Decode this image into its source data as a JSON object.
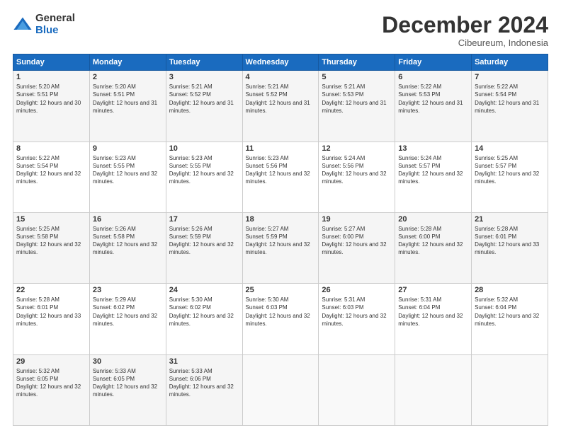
{
  "logo": {
    "general": "General",
    "blue": "Blue"
  },
  "title": "December 2024",
  "location": "Cibeureum, Indonesia",
  "days_of_week": [
    "Sunday",
    "Monday",
    "Tuesday",
    "Wednesday",
    "Thursday",
    "Friday",
    "Saturday"
  ],
  "weeks": [
    [
      {
        "day": "1",
        "sunrise": "5:20 AM",
        "sunset": "5:51 PM",
        "daylight": "12 hours and 30 minutes."
      },
      {
        "day": "2",
        "sunrise": "5:20 AM",
        "sunset": "5:51 PM",
        "daylight": "12 hours and 31 minutes."
      },
      {
        "day": "3",
        "sunrise": "5:21 AM",
        "sunset": "5:52 PM",
        "daylight": "12 hours and 31 minutes."
      },
      {
        "day": "4",
        "sunrise": "5:21 AM",
        "sunset": "5:52 PM",
        "daylight": "12 hours and 31 minutes."
      },
      {
        "day": "5",
        "sunrise": "5:21 AM",
        "sunset": "5:53 PM",
        "daylight": "12 hours and 31 minutes."
      },
      {
        "day": "6",
        "sunrise": "5:22 AM",
        "sunset": "5:53 PM",
        "daylight": "12 hours and 31 minutes."
      },
      {
        "day": "7",
        "sunrise": "5:22 AM",
        "sunset": "5:54 PM",
        "daylight": "12 hours and 31 minutes."
      }
    ],
    [
      {
        "day": "8",
        "sunrise": "5:22 AM",
        "sunset": "5:54 PM",
        "daylight": "12 hours and 32 minutes."
      },
      {
        "day": "9",
        "sunrise": "5:23 AM",
        "sunset": "5:55 PM",
        "daylight": "12 hours and 32 minutes."
      },
      {
        "day": "10",
        "sunrise": "5:23 AM",
        "sunset": "5:55 PM",
        "daylight": "12 hours and 32 minutes."
      },
      {
        "day": "11",
        "sunrise": "5:23 AM",
        "sunset": "5:56 PM",
        "daylight": "12 hours and 32 minutes."
      },
      {
        "day": "12",
        "sunrise": "5:24 AM",
        "sunset": "5:56 PM",
        "daylight": "12 hours and 32 minutes."
      },
      {
        "day": "13",
        "sunrise": "5:24 AM",
        "sunset": "5:57 PM",
        "daylight": "12 hours and 32 minutes."
      },
      {
        "day": "14",
        "sunrise": "5:25 AM",
        "sunset": "5:57 PM",
        "daylight": "12 hours and 32 minutes."
      }
    ],
    [
      {
        "day": "15",
        "sunrise": "5:25 AM",
        "sunset": "5:58 PM",
        "daylight": "12 hours and 32 minutes."
      },
      {
        "day": "16",
        "sunrise": "5:26 AM",
        "sunset": "5:58 PM",
        "daylight": "12 hours and 32 minutes."
      },
      {
        "day": "17",
        "sunrise": "5:26 AM",
        "sunset": "5:59 PM",
        "daylight": "12 hours and 32 minutes."
      },
      {
        "day": "18",
        "sunrise": "5:27 AM",
        "sunset": "5:59 PM",
        "daylight": "12 hours and 32 minutes."
      },
      {
        "day": "19",
        "sunrise": "5:27 AM",
        "sunset": "6:00 PM",
        "daylight": "12 hours and 32 minutes."
      },
      {
        "day": "20",
        "sunrise": "5:28 AM",
        "sunset": "6:00 PM",
        "daylight": "12 hours and 32 minutes."
      },
      {
        "day": "21",
        "sunrise": "5:28 AM",
        "sunset": "6:01 PM",
        "daylight": "12 hours and 33 minutes."
      }
    ],
    [
      {
        "day": "22",
        "sunrise": "5:28 AM",
        "sunset": "6:01 PM",
        "daylight": "12 hours and 33 minutes."
      },
      {
        "day": "23",
        "sunrise": "5:29 AM",
        "sunset": "6:02 PM",
        "daylight": "12 hours and 32 minutes."
      },
      {
        "day": "24",
        "sunrise": "5:30 AM",
        "sunset": "6:02 PM",
        "daylight": "12 hours and 32 minutes."
      },
      {
        "day": "25",
        "sunrise": "5:30 AM",
        "sunset": "6:03 PM",
        "daylight": "12 hours and 32 minutes."
      },
      {
        "day": "26",
        "sunrise": "5:31 AM",
        "sunset": "6:03 PM",
        "daylight": "12 hours and 32 minutes."
      },
      {
        "day": "27",
        "sunrise": "5:31 AM",
        "sunset": "6:04 PM",
        "daylight": "12 hours and 32 minutes."
      },
      {
        "day": "28",
        "sunrise": "5:32 AM",
        "sunset": "6:04 PM",
        "daylight": "12 hours and 32 minutes."
      }
    ],
    [
      {
        "day": "29",
        "sunrise": "5:32 AM",
        "sunset": "6:05 PM",
        "daylight": "12 hours and 32 minutes."
      },
      {
        "day": "30",
        "sunrise": "5:33 AM",
        "sunset": "6:05 PM",
        "daylight": "12 hours and 32 minutes."
      },
      {
        "day": "31",
        "sunrise": "5:33 AM",
        "sunset": "6:06 PM",
        "daylight": "12 hours and 32 minutes."
      },
      null,
      null,
      null,
      null
    ]
  ]
}
